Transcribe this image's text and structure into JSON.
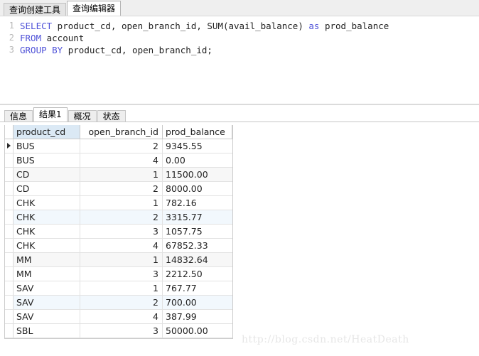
{
  "top_tabs": [
    {
      "label": "查询创建工具",
      "active": false
    },
    {
      "label": "查询编辑器",
      "active": true
    }
  ],
  "editor": {
    "lines": [
      {
        "number": "1",
        "tokens": [
          {
            "t": "SELECT",
            "kw": true
          },
          {
            "t": " product_cd, open_branch_id, SUM(avail_balance) ",
            "kw": false
          },
          {
            "t": "as",
            "kw": true
          },
          {
            "t": " prod_balance",
            "kw": false
          }
        ]
      },
      {
        "number": "2",
        "tokens": [
          {
            "t": "FROM",
            "kw": true
          },
          {
            "t": " account",
            "kw": false
          }
        ]
      },
      {
        "number": "3",
        "tokens": [
          {
            "t": "GROUP BY",
            "kw": true
          },
          {
            "t": " product_cd, open_branch_id;",
            "kw": false
          }
        ]
      }
    ]
  },
  "result_tabs": [
    {
      "label": "信息",
      "active": false
    },
    {
      "label": "结果1",
      "active": true
    },
    {
      "label": "概况",
      "active": false
    },
    {
      "label": "状态",
      "active": false
    }
  ],
  "grid": {
    "columns": [
      "product_cd",
      "open_branch_id",
      "prod_balance"
    ],
    "selected_row_index": 0,
    "rows": [
      {
        "product_cd": "BUS",
        "open_branch_id": "2",
        "prod_balance": "9345.55",
        "stripe": ""
      },
      {
        "product_cd": "BUS",
        "open_branch_id": "4",
        "prod_balance": "0.00",
        "stripe": ""
      },
      {
        "product_cd": "CD",
        "open_branch_id": "1",
        "prod_balance": "11500.00",
        "stripe": "gray"
      },
      {
        "product_cd": "CD",
        "open_branch_id": "2",
        "prod_balance": "8000.00",
        "stripe": ""
      },
      {
        "product_cd": "CHK",
        "open_branch_id": "1",
        "prod_balance": "782.16",
        "stripe": ""
      },
      {
        "product_cd": "CHK",
        "open_branch_id": "2",
        "prod_balance": "3315.77",
        "stripe": "blue"
      },
      {
        "product_cd": "CHK",
        "open_branch_id": "3",
        "prod_balance": "1057.75",
        "stripe": ""
      },
      {
        "product_cd": "CHK",
        "open_branch_id": "4",
        "prod_balance": "67852.33",
        "stripe": ""
      },
      {
        "product_cd": "MM",
        "open_branch_id": "1",
        "prod_balance": "14832.64",
        "stripe": "gray"
      },
      {
        "product_cd": "MM",
        "open_branch_id": "3",
        "prod_balance": "2212.50",
        "stripe": ""
      },
      {
        "product_cd": "SAV",
        "open_branch_id": "1",
        "prod_balance": "767.77",
        "stripe": ""
      },
      {
        "product_cd": "SAV",
        "open_branch_id": "2",
        "prod_balance": "700.00",
        "stripe": "blue"
      },
      {
        "product_cd": "SAV",
        "open_branch_id": "4",
        "prod_balance": "387.99",
        "stripe": ""
      },
      {
        "product_cd": "SBL",
        "open_branch_id": "3",
        "prod_balance": "50000.00",
        "stripe": ""
      }
    ]
  },
  "watermark": "http://blog.csdn.net/HeatDeath"
}
